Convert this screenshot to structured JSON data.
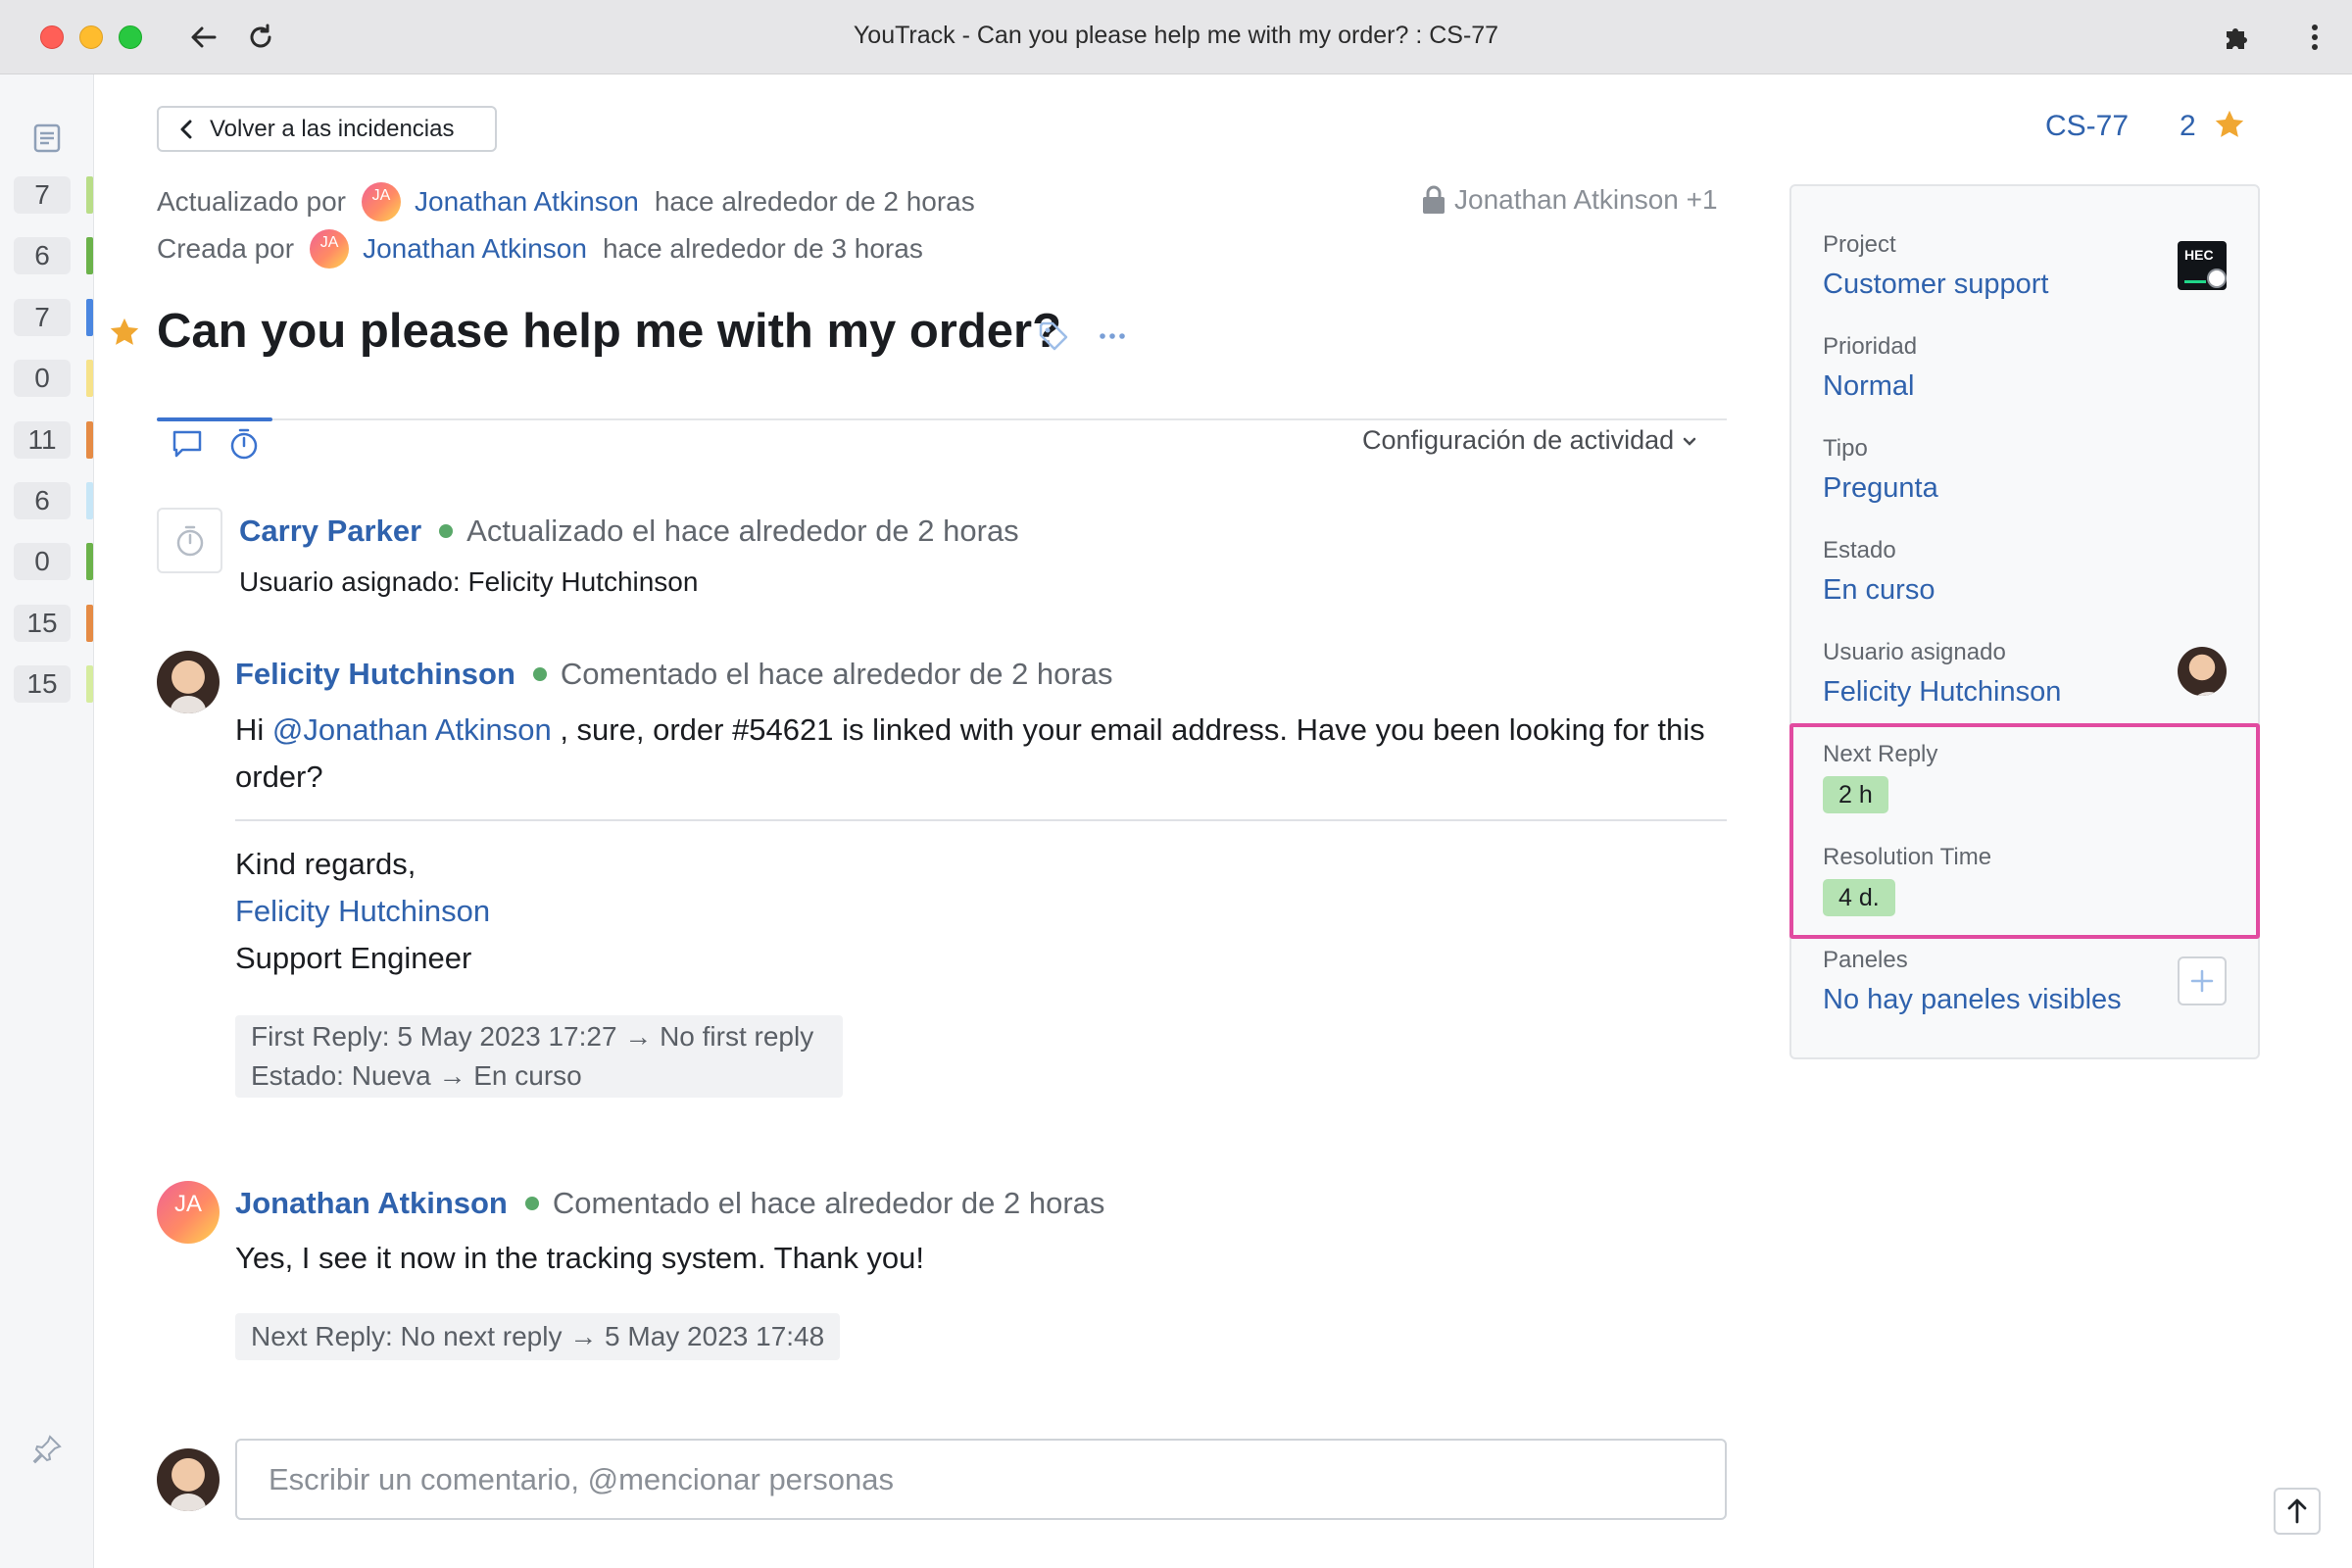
{
  "browser": {
    "title": "YouTrack - Can you please help me with my order? : CS-77"
  },
  "sidebar": {
    "counts": [
      {
        "value": "7",
        "color": "#b9dd88"
      },
      {
        "value": "6",
        "color": "#6bb24a"
      },
      {
        "value": "7",
        "color": "#4a86e0"
      },
      {
        "value": "0",
        "color": "#f6e28a"
      },
      {
        "value": "11",
        "color": "#e58b45"
      },
      {
        "value": "6",
        "color": "#c7e6f7"
      },
      {
        "value": "0",
        "color": "#6bb24a"
      },
      {
        "value": "15",
        "color": "#e58b45"
      },
      {
        "value": "15",
        "color": "#d6ec9f"
      }
    ]
  },
  "issue": {
    "back_label": "Volver a las incidencias",
    "updated_by_label": "Actualizado por",
    "updated_by_user": "Jonathan Atkinson",
    "updated_when": "hace alrededor de 2 horas",
    "created_by_label": "Creada por",
    "created_by_user": "Jonathan Atkinson",
    "created_when": "hace alrededor de 3 horas",
    "avatar_initials": "JA",
    "visibility": "Jonathan Atkinson +1",
    "title": "Can you please help me with my order?",
    "activity_settings": "Configuración de actividad",
    "id": "CS-77",
    "star_count": "2"
  },
  "activity": {
    "event": {
      "author": "Carry Parker",
      "when": "Actualizado el hace alrededor de 2 horas",
      "change": "Usuario asignado: Felicity Hutchinson"
    },
    "comment1": {
      "author": "Felicity Hutchinson",
      "when": "Comentado el hace alrededor de 2 horas",
      "text_prefix": "Hi ",
      "mention": "@Jonathan Atkinson",
      "text_suffix": " , sure, order #54621 is linked with your email address. Have you been looking for this order?",
      "sign_greeting": "Kind regards,",
      "sign_name": "Felicity Hutchinson",
      "sign_role": "Support Engineer",
      "change1": "First Reply: 5 May 2023 17:27 → No first reply",
      "change2": "Estado: Nueva → En curso"
    },
    "comment2": {
      "author": "Jonathan Atkinson",
      "avatar_initials": "JA",
      "when": "Comentado el hace alrededor de 2 horas",
      "text": "Yes, I see it now in the tracking system. Thank you!",
      "change": "Next Reply: No next reply → 5 May 2023 17:48"
    },
    "comment_input_placeholder": "Escribir un comentario, @mencionar personas"
  },
  "fields": {
    "project_label": "Project",
    "project_value": "Customer support",
    "project_icon_text": "HEC",
    "priority_label": "Prioridad",
    "priority_value": "Normal",
    "type_label": "Tipo",
    "type_value": "Pregunta",
    "state_label": "Estado",
    "state_value": "En curso",
    "assignee_label": "Usuario asignado",
    "assignee_value": "Felicity Hutchinson",
    "next_reply_label": "Next Reply",
    "next_reply_value": "2 h",
    "resolution_label": "Resolution Time",
    "resolution_value": "4 d.",
    "panels_label": "Paneles",
    "panels_value": "No hay paneles visibles"
  },
  "colors": {
    "link": "#2f62ad",
    "sla_badge": "#b5e3b3",
    "highlight": "#e14ba0",
    "star": "#f0a732"
  }
}
